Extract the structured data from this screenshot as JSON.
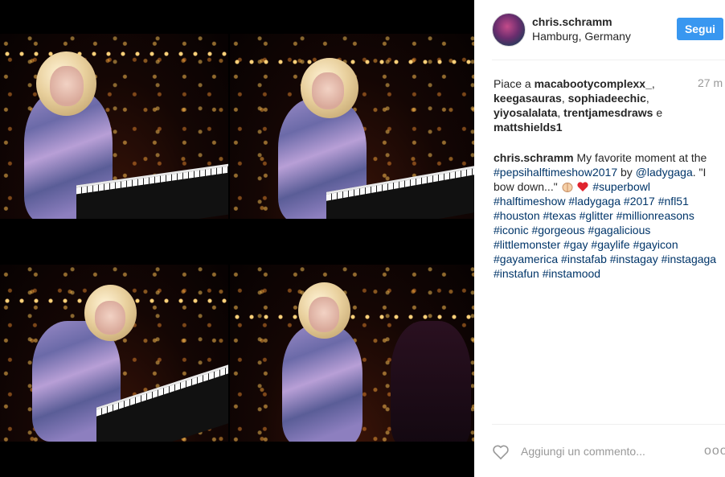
{
  "post": {
    "username": "chris.schramm",
    "location": "Hamburg, Germany",
    "follow_label": "Segui",
    "likes_prefix": "Piace a ",
    "likers": [
      "macabootycomplexx_",
      "keegasauras",
      "sophiadeechic",
      "yiyosalalata",
      "trentjamesdraws",
      "mattshields1"
    ],
    "likes_sep1": ", ",
    "likes_and": " e ",
    "time": "27 m",
    "caption_author": "chris.schramm",
    "caption_text_1": " My favorite moment at the ",
    "caption_tag_1": "#pepsihalftimeshow2017",
    "caption_text_2": " by ",
    "caption_mention": "@ladygaga",
    "caption_text_3": ". \"I bow down...\" ",
    "caption_tags": [
      "#superbowl",
      "#halftimeshow",
      "#ladygaga",
      "#2017",
      "#nfl51",
      "#houston",
      "#texas",
      "#glitter",
      "#millionreasons",
      "#iconic",
      "#gorgeous",
      "#gagalicious",
      "#littlemonster",
      "#gay",
      "#gaylife",
      "#gayicon",
      "#gayamerica",
      "#instafab",
      "#instagay",
      "#instagaga",
      "#instafun",
      "#instamood"
    ],
    "comment_placeholder": "Aggiungi un commento...",
    "more_label": "ooo"
  },
  "icons": {
    "heart": "heart-icon",
    "more": "more-options-icon",
    "emoji_1": "folded-hands-emoji",
    "emoji_2": "red-heart-emoji"
  },
  "colors": {
    "follow_button": "#3897f0",
    "hashtag": "#003569",
    "muted": "#999999"
  }
}
